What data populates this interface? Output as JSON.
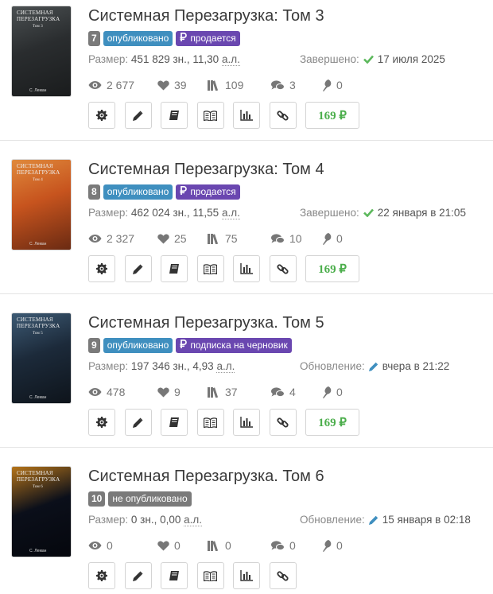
{
  "books": [
    {
      "cover_title": "Системная Перезагрузка",
      "cover_sub": "Том 3",
      "cover_author": "С. Леман",
      "cover_colors": [
        "#2a2d2f",
        "#4b5052",
        "#1a1c1d"
      ],
      "title": "Системная Перезагрузка: Том 3",
      "number": "7",
      "badge_status": "опубликовано",
      "badge_extra": "продается",
      "size_label": "Размер:",
      "size_chars": "451 829 зн.,",
      "size_al_num": "11,30",
      "size_al_unit": "а.л.",
      "status_label": "Завершено:",
      "status_icon": "check-icon",
      "status_value": "17 июля 2025",
      "views": "2 677",
      "likes": "39",
      "library": "109",
      "comments": "3",
      "awards": "0",
      "price": "169 ₽"
    },
    {
      "cover_title": "Системная Перезагрузка",
      "cover_sub": "Том 4",
      "cover_author": "С. Леман",
      "cover_colors": [
        "#c7541e",
        "#e08a3c",
        "#6a2a12"
      ],
      "title": "Системная Перезагрузка: Том 4",
      "number": "8",
      "badge_status": "опубликовано",
      "badge_extra": "продается",
      "size_label": "Размер:",
      "size_chars": "462 024 зн.,",
      "size_al_num": "11,55",
      "size_al_unit": "а.л.",
      "status_label": "Завершено:",
      "status_icon": "check-icon",
      "status_value": "22 января в 21:05",
      "views": "2 327",
      "likes": "25",
      "library": "75",
      "comments": "10",
      "awards": "0",
      "price": "169 ₽"
    },
    {
      "cover_title": "Системная Перезагрузка",
      "cover_sub": "Том 5",
      "cover_author": "С. Леман",
      "cover_colors": [
        "#1c2a3a",
        "#3d5a74",
        "#0e141b"
      ],
      "title": "Системная Перезагрузка. Том 5",
      "number": "9",
      "badge_status": "опубликовано",
      "badge_extra": "подписка на черновик",
      "size_label": "Размер:",
      "size_chars": "197 346 зн.,",
      "size_al_num": "4,93",
      "size_al_unit": "а.л.",
      "status_label": "Обновление:",
      "status_icon": "pencil-icon",
      "status_value": "вчера в 21:22",
      "views": "478",
      "likes": "9",
      "library": "37",
      "comments": "4",
      "awards": "0",
      "price": "169 ₽"
    },
    {
      "cover_title": "Системная Перезагрузка",
      "cover_sub": "Том 6",
      "cover_author": "С. Леман",
      "cover_colors": [
        "#0b0f1a",
        "#b5741a",
        "#05070d"
      ],
      "title": "Системная Перезагрузка. Том 6",
      "number": "10",
      "badge_status": "не опубликовано",
      "badge_extra": "",
      "size_label": "Размер:",
      "size_chars": "0 зн.,",
      "size_al_num": "0,00",
      "size_al_unit": "а.л.",
      "status_label": "Обновление:",
      "status_icon": "pencil-icon",
      "status_value": "15 января в 02:18",
      "views": "0",
      "likes": "0",
      "library": "0",
      "comments": "0",
      "awards": "0",
      "price": ""
    }
  ],
  "colors": {
    "published": "#3f8fbf",
    "for_sale": "#6a47b0",
    "unpublished": "#7a7a7a",
    "check": "#5cb85c",
    "price": "#4cae4c",
    "pencil": "#3f8fbf"
  }
}
